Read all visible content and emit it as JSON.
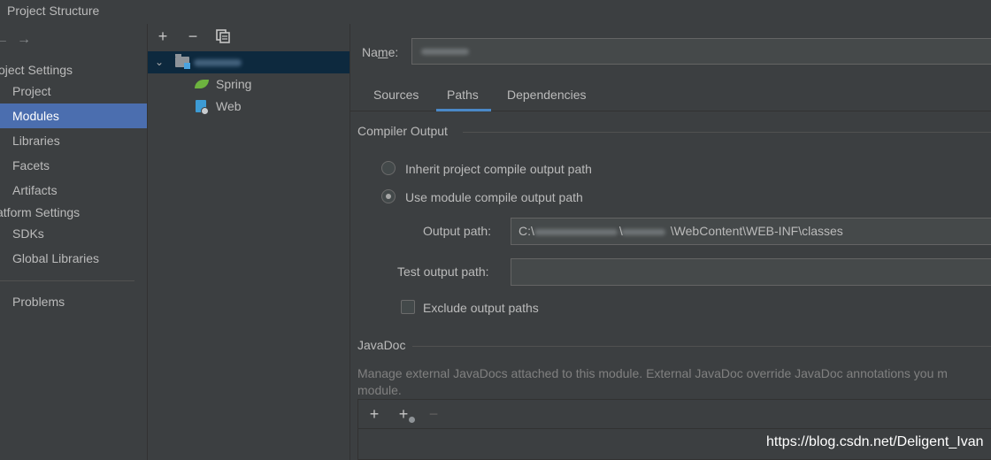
{
  "window": {
    "title": "Project Structure"
  },
  "sidebar": {
    "nav": {
      "back_icon": "arrow-left-icon",
      "forward_icon": "arrow-right-icon"
    },
    "project_settings_header": "oject Settings",
    "project_items": [
      {
        "label": "Project",
        "selected": false
      },
      {
        "label": "Modules",
        "selected": true
      },
      {
        "label": "Libraries",
        "selected": false
      },
      {
        "label": "Facets",
        "selected": false
      },
      {
        "label": "Artifacts",
        "selected": false
      }
    ],
    "platform_settings_header": "atform Settings",
    "platform_items": [
      {
        "label": "SDKs"
      },
      {
        "label": "Global Libraries"
      }
    ],
    "problems_label": "Problems"
  },
  "tree": {
    "toolbar": {
      "add_icon": "plus-icon",
      "remove_icon": "minus-icon",
      "copy_icon": "copy-icon"
    },
    "root": {
      "expanded": true,
      "icon": "module-folder-icon"
    },
    "children": [
      {
        "label": "Spring",
        "icon": "spring-leaf-icon"
      },
      {
        "label": "Web",
        "icon": "web-module-icon"
      }
    ]
  },
  "content": {
    "name_label_prefix": "Na",
    "name_label_mnemonic": "m",
    "name_label_suffix": "e:",
    "tabs": [
      {
        "label": "Sources",
        "active": false
      },
      {
        "label": "Paths",
        "active": true
      },
      {
        "label": "Dependencies",
        "active": false
      }
    ],
    "compiler_output": {
      "title": "Compiler Output",
      "inherit_label": "Inherit project compile output path",
      "use_module_label": "Use module compile output path",
      "selected": "use_module",
      "output_path_label": "Output path:",
      "output_path_segments": [
        "C:\\",
        "\\",
        "\\WebContent\\WEB-INF\\classes"
      ],
      "test_output_path_label": "Test output path:",
      "test_output_path_value": "",
      "exclude_label": "Exclude output paths",
      "exclude_checked": false
    },
    "javadoc": {
      "title": "JavaDoc",
      "description_line1": "Manage external JavaDocs attached to this module. External JavaDoc override JavaDoc annotations you m",
      "description_line2": "module.",
      "toolbar": {
        "add_icon": "plus-icon",
        "add_url_icon": "add-url-icon",
        "remove_icon": "minus-icon"
      }
    }
  },
  "watermark": "https://blog.csdn.net/Deligent_Ivan",
  "colors": {
    "background": "#3c3f41",
    "selection": "#4b6eaf",
    "tree_selection": "#0d293e",
    "tab_underline": "#4a88c7",
    "text": "#bbbbbb",
    "muted_text": "#808080"
  }
}
